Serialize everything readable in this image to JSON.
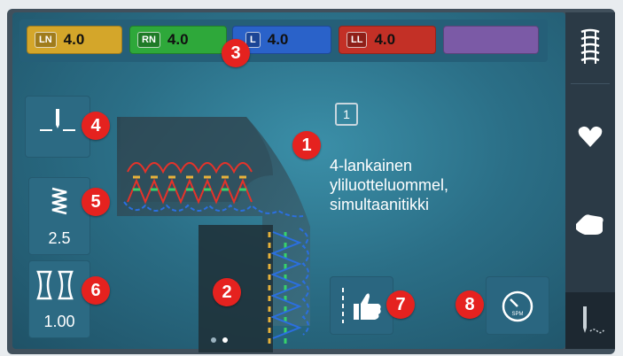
{
  "threads": [
    {
      "tag": "LN",
      "value": "4.0",
      "color": "#d4a62a"
    },
    {
      "tag": "RN",
      "value": "4.0",
      "color": "#2ea83a"
    },
    {
      "tag": "L",
      "value": "4.0",
      "color": "#2a62c9"
    },
    {
      "tag": "LL",
      "value": "4.0",
      "color": "#c33026"
    },
    {
      "tag": "",
      "value": "",
      "color": "#7b5aa6"
    }
  ],
  "stitch": {
    "number": "1",
    "name_lines": [
      "4-lankainen",
      "yliluotteluommel,",
      "simultaanitikki"
    ]
  },
  "controls": {
    "stitch_length": "2.5",
    "differential_feed": "1.00"
  },
  "badges": [
    "1",
    "2",
    "3",
    "4",
    "5",
    "6",
    "7",
    "8"
  ],
  "pager": {
    "pages": 2,
    "current": 2
  },
  "sidebar": [
    "overlock-stitch-icon",
    "heart-icon",
    "hand-icon",
    "needle-icon"
  ]
}
